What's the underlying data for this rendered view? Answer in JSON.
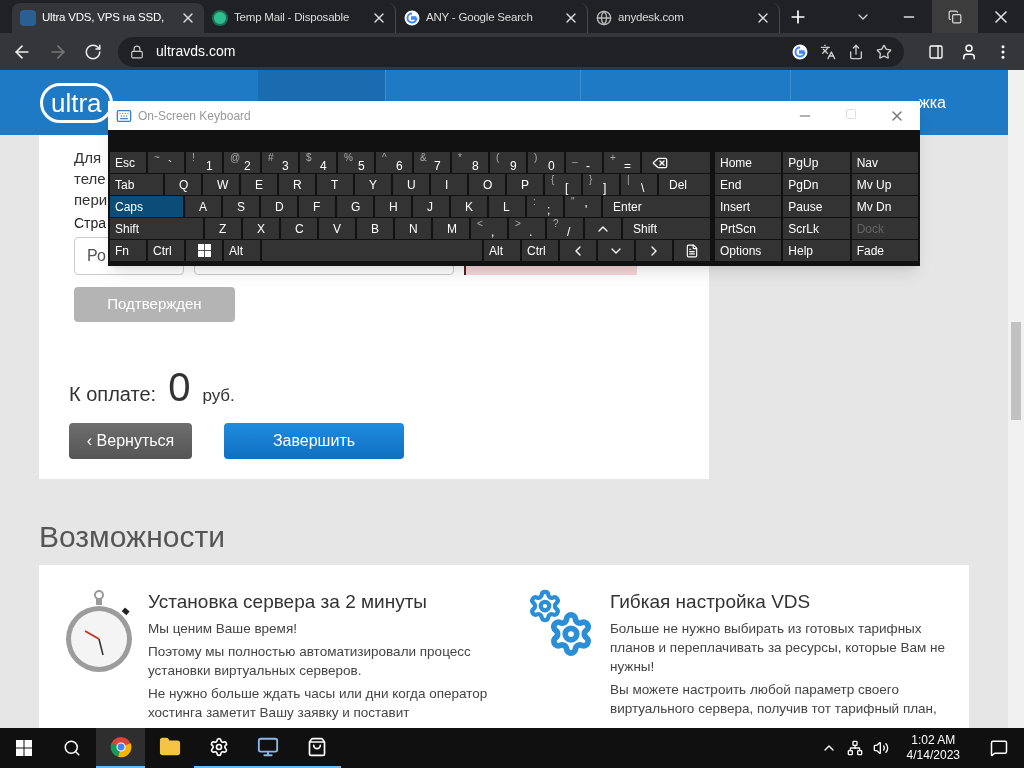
{
  "browser": {
    "tabs": [
      {
        "kind": "ultra",
        "title": "Ultra VDS, VPS на SSD,",
        "selected": true
      },
      {
        "kind": "tempmail",
        "title": "Temp Mail - Disposable",
        "selected": false
      },
      {
        "kind": "google",
        "title": "ANY - Google Search",
        "selected": false
      },
      {
        "kind": "globe",
        "title": "anydesk.com",
        "selected": false
      }
    ],
    "address": "ultravds.com",
    "forward_disabled": true
  },
  "page": {
    "logo": {
      "small": "ultra"
    },
    "nav_fragment": "жка",
    "form": {
      "lines": [
        "Для",
        "теле",
        "пери"
      ],
      "label": "Стра",
      "country_value": "Ро",
      "confirm_button": {
        "label": "Подтвержден",
        "disabled": true
      }
    },
    "total": {
      "label": "К оплате:",
      "amount": "0",
      "currency": "руб."
    },
    "back_button": "‹ Вернуться",
    "finish_button": "Завершить",
    "features": {
      "heading": "Возможности",
      "items": [
        {
          "kind": "stopwatch",
          "title": "Установка сервера за 2 минуты",
          "paragraphs": [
            "Мы ценим Ваше время!",
            "Поэтому мы полностью автоматизировали процесс установки виртуальных серверов.",
            "Не нужно больше ждать часы или дни когда оператор хостинга заметит Вашу заявку и поставит"
          ]
        },
        {
          "kind": "gears",
          "title": "Гибкая настройка VDS",
          "paragraphs": [
            "Больше не нужно выбирать из готовых тарифных планов и переплачивать за ресурсы, которые Вам не нужны!",
            "Вы можете настроить любой параметр своего виртуального сервера, получив тот тарифный план,"
          ]
        }
      ]
    }
  },
  "keyboard": {
    "title": "On-Screen Keyboard",
    "caps_on": true,
    "rows": [
      [
        {
          "kind": "key",
          "label": "Esc"
        },
        {
          "kind": "char",
          "shift": "~",
          "main": "`"
        },
        {
          "kind": "char",
          "shift": "!",
          "main": "1"
        },
        {
          "kind": "char",
          "shift": "@",
          "main": "2"
        },
        {
          "kind": "char",
          "shift": "#",
          "main": "3"
        },
        {
          "kind": "char",
          "shift": "$",
          "main": "4"
        },
        {
          "kind": "char",
          "shift": "%",
          "main": "5"
        },
        {
          "kind": "char",
          "shift": "^",
          "main": "6"
        },
        {
          "kind": "char",
          "shift": "&",
          "main": "7"
        },
        {
          "kind": "char",
          "shift": "*",
          "main": "8"
        },
        {
          "kind": "char",
          "shift": "(",
          "main": "9"
        },
        {
          "kind": "char",
          "shift": ")",
          "main": "0"
        },
        {
          "kind": "char",
          "shift": "_",
          "main": "-"
        },
        {
          "kind": "char",
          "shift": "+",
          "main": "="
        },
        {
          "kind": "backspace"
        }
      ],
      [
        {
          "kind": "key",
          "label": "Tab"
        },
        {
          "kind": "char",
          "main": "Q"
        },
        {
          "kind": "char",
          "main": "W"
        },
        {
          "kind": "char",
          "main": "E"
        },
        {
          "kind": "char",
          "main": "R"
        },
        {
          "kind": "char",
          "main": "T"
        },
        {
          "kind": "char",
          "main": "Y"
        },
        {
          "kind": "char",
          "main": "U"
        },
        {
          "kind": "char",
          "main": "I"
        },
        {
          "kind": "char",
          "main": "O"
        },
        {
          "kind": "char",
          "main": "P"
        },
        {
          "kind": "char",
          "shift": "{",
          "main": "["
        },
        {
          "kind": "char",
          "shift": "}",
          "main": "]"
        },
        {
          "kind": "char",
          "shift": "|",
          "main": "\\"
        },
        {
          "kind": "stretch",
          "label": "Del"
        }
      ],
      [
        {
          "kind": "caps",
          "label": "Caps"
        },
        {
          "kind": "char",
          "main": "A"
        },
        {
          "kind": "char",
          "main": "S"
        },
        {
          "kind": "char",
          "main": "D"
        },
        {
          "kind": "char",
          "main": "F"
        },
        {
          "kind": "char",
          "main": "G"
        },
        {
          "kind": "char",
          "main": "H"
        },
        {
          "kind": "char",
          "main": "J"
        },
        {
          "kind": "char",
          "main": "K"
        },
        {
          "kind": "char",
          "main": "L"
        },
        {
          "kind": "char",
          "shift": ":",
          "main": ";"
        },
        {
          "kind": "char",
          "shift": "\"",
          "main": "'"
        },
        {
          "kind": "stretch",
          "label": "Enter"
        }
      ],
      [
        {
          "kind": "key",
          "label": "Shift"
        },
        {
          "kind": "char",
          "main": "Z"
        },
        {
          "kind": "char",
          "main": "X"
        },
        {
          "kind": "char",
          "main": "C"
        },
        {
          "kind": "char",
          "main": "V"
        },
        {
          "kind": "char",
          "main": "B"
        },
        {
          "kind": "char",
          "main": "N"
        },
        {
          "kind": "char",
          "main": "M"
        },
        {
          "kind": "char",
          "shift": "<",
          "main": ","
        },
        {
          "kind": "char",
          "shift": ">",
          "main": "."
        },
        {
          "kind": "char",
          "shift": "?",
          "main": "/"
        },
        {
          "kind": "up"
        },
        {
          "kind": "stretch",
          "label": "Shift"
        }
      ],
      [
        {
          "kind": "key",
          "label": "Fn"
        },
        {
          "kind": "key",
          "label": "Ctrl"
        },
        {
          "kind": "windows"
        },
        {
          "kind": "key",
          "label": "Alt"
        },
        {
          "kind": "space"
        },
        {
          "kind": "key",
          "label": "Alt"
        },
        {
          "kind": "key",
          "label": "Ctrl"
        },
        {
          "kind": "left"
        },
        {
          "kind": "down"
        },
        {
          "kind": "right"
        },
        {
          "kind": "menu"
        }
      ]
    ],
    "side": [
      [
        {
          "label": "Home",
          "disabled": false
        },
        {
          "label": "PgUp",
          "disabled": false
        },
        {
          "label": "Nav",
          "disabled": false
        }
      ],
      [
        {
          "label": "End",
          "disabled": false
        },
        {
          "label": "PgDn",
          "disabled": false
        },
        {
          "label": "Mv Up",
          "disabled": false
        }
      ],
      [
        {
          "label": "Insert",
          "disabled": false
        },
        {
          "label": "Pause",
          "disabled": false
        },
        {
          "label": "Mv Dn",
          "disabled": false
        }
      ],
      [
        {
          "label": "PrtScn",
          "disabled": false
        },
        {
          "label": "ScrLk",
          "disabled": false
        },
        {
          "label": "Dock",
          "disabled": true
        }
      ],
      [
        {
          "label": "Options",
          "disabled": false
        },
        {
          "label": "Help",
          "disabled": false
        },
        {
          "label": "Fade",
          "disabled": false
        }
      ]
    ]
  },
  "taskbar": {
    "apps": [
      {
        "kind": "chrome",
        "active": true,
        "running": true
      },
      {
        "kind": "folder",
        "active": false,
        "running": false
      },
      {
        "kind": "settings",
        "active": false,
        "running": true
      },
      {
        "kind": "monitor",
        "active": false,
        "running": true
      },
      {
        "kind": "store",
        "active": false,
        "running": true
      }
    ],
    "time": "1:02 AM",
    "date": "4/14/2023"
  }
}
